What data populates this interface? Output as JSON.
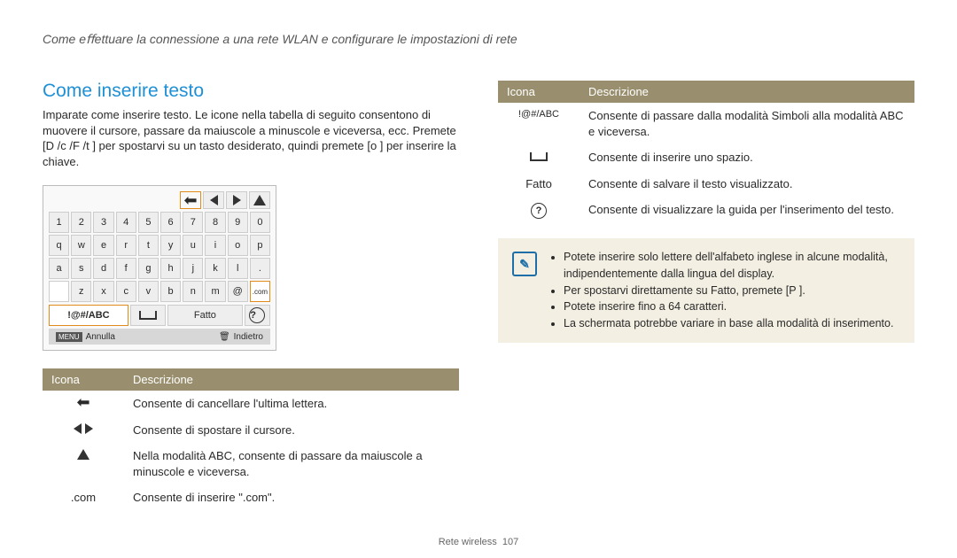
{
  "breadcrumb": "Come eﬀettuare la connessione a una rete WLAN e conﬁgurare le impostazioni di rete",
  "section_title": "Come inserire testo",
  "intro": "Imparate come inserire testo. Le icone nella tabella di seguito consentono di muovere il cursore, passare da maiuscole a minuscole e viceversa, ecc. Premete [D /c /F /t ] per spostarvi su un tasto desiderato, quindi premete [o ] per inserire la chiave.",
  "keyboard": {
    "row1": [
      "1",
      "2",
      "3",
      "4",
      "5",
      "6",
      "7",
      "8",
      "9",
      "0"
    ],
    "row2": [
      "q",
      "w",
      "e",
      "r",
      "t",
      "y",
      "u",
      "i",
      "o",
      "p"
    ],
    "row3": [
      "a",
      "s",
      "d",
      "f",
      "g",
      "h",
      "j",
      "k",
      "l",
      "."
    ],
    "row4_blank": "",
    "row4": [
      "z",
      "x",
      "c",
      "v",
      "b",
      "n",
      "m",
      "@",
      ".com"
    ],
    "bottom_mode": "!@#/ABC",
    "bottom_done": "Fatto",
    "foot_menu": "MENU",
    "foot_annulla": "Annulla",
    "foot_indietro": "Indietro"
  },
  "table_header_icon": "Icona",
  "table_header_desc": "Descrizione",
  "left_rows": {
    "r0_desc": "Consente di cancellare l'ultima lettera.",
    "r1_desc": "Consente di spostare il cursore.",
    "r2_desc": "Nella modalità ABC, consente di passare da maiuscole a minuscole e viceversa.",
    "r3_icon": ".com",
    "r3_desc": "Consente di inserire \".com\"."
  },
  "right_rows": {
    "r0_icon": "!@#/ABC",
    "r0_desc": "Consente di passare dalla modalità Simboli alla modalità ABC e viceversa.",
    "r1_desc": "Consente di inserire uno spazio.",
    "r2_icon": "Fatto",
    "r2_desc": "Consente di salvare il testo visualizzato.",
    "r3_desc": "Consente di visualizzare la guida per l'inserimento del testo."
  },
  "notes": {
    "n0": "Potete inserire solo lettere dell'alfabeto inglese in alcune modalità, indipendentemente dalla lingua del display.",
    "n1": "Per spostarvi direttamente su Fatto, premete [P ].",
    "n2": "Potete inserire ﬁno a 64 caratteri.",
    "n3": "La schermata potrebbe variare in base alla modalità di inserimento."
  },
  "footer_section": "Rete wireless",
  "footer_page": "107"
}
